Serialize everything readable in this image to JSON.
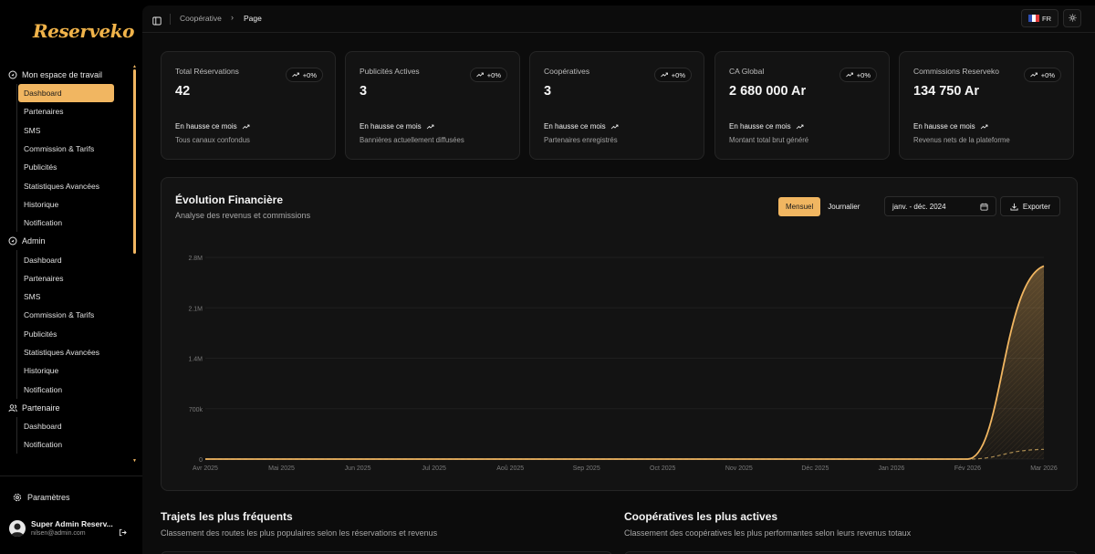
{
  "app": {
    "logo_text": "Reserveko"
  },
  "sidebar": {
    "groups": [
      {
        "label": "Mon espace de travail",
        "items": [
          "Dashboard",
          "Partenaires",
          "SMS",
          "Commission & Tarifs",
          "Publicités",
          "Statistiques Avancées",
          "Historique",
          "Notification"
        ],
        "active_index": 0
      },
      {
        "label": "Admin",
        "items": [
          "Dashboard",
          "Partenaires",
          "SMS",
          "Commission & Tarifs",
          "Publicités",
          "Statistiques Avancées",
          "Historique",
          "Notification"
        ]
      },
      {
        "label": "Partenaire",
        "items": [
          "Dashboard",
          "Notification"
        ]
      }
    ],
    "settings_label": "Paramètres",
    "user": {
      "name": "Super Admin Reserv...",
      "email": "nilsen@admin.com"
    }
  },
  "topbar": {
    "breadcrumb": [
      "Coopérative",
      "Page"
    ],
    "language": "FR"
  },
  "stats": [
    {
      "title": "Total Réservations",
      "badge": "+0%",
      "value": "42",
      "trend": "En hausse ce mois",
      "desc": "Tous canaux confondus"
    },
    {
      "title": "Publicités Actives",
      "badge": "+0%",
      "value": "3",
      "trend": "En hausse ce mois",
      "desc": "Bannières actuellement diffusées"
    },
    {
      "title": "Coopératives",
      "badge": "+0%",
      "value": "3",
      "trend": "En hausse ce mois",
      "desc": "Partenaires enregistrés"
    },
    {
      "title": "CA Global",
      "badge": "+0%",
      "value": "2 680 000 Ar",
      "trend": "En hausse ce mois",
      "desc": "Montant total brut généré"
    },
    {
      "title": "Commissions Reserveko",
      "badge": "+0%",
      "value": "134 750 Ar",
      "trend": "En hausse ce mois",
      "desc": "Revenus nets de la plateforme"
    }
  ],
  "chart_section": {
    "title": "Évolution Financière",
    "subtitle": "Analyse des revenus et commissions",
    "toggle": [
      "Mensuel",
      "Journalier"
    ],
    "toggle_active": "Mensuel",
    "date_range": "janv. - déc. 2024",
    "export_label": "Exporter"
  },
  "chart_data": {
    "type": "area",
    "x": [
      "Avr 2025",
      "Mai 2025",
      "Jun 2025",
      "Jul 2025",
      "Aoû 2025",
      "Sep 2025",
      "Oct 2025",
      "Nov 2025",
      "Déc 2025",
      "Jan 2026",
      "Fév 2026",
      "Mar 2026"
    ],
    "y_ticks": [
      "0",
      "700k",
      "1.4M",
      "2.1M",
      "2.8M"
    ],
    "ylim": [
      0,
      2800000
    ],
    "series": [
      {
        "values": [
          0,
          0,
          0,
          0,
          0,
          0,
          0,
          0,
          0,
          0,
          0,
          2680000
        ],
        "color": "#f1b661",
        "style": "solid"
      },
      {
        "values": [
          0,
          0,
          0,
          0,
          0,
          0,
          0,
          0,
          0,
          0,
          0,
          134750
        ],
        "color": "#c9a45e",
        "style": "dashed"
      }
    ],
    "grid": true
  },
  "bottom": {
    "left": {
      "title": "Trajets les plus fréquents",
      "subtitle": "Classement des routes les plus populaires selon les réservations et revenus"
    },
    "right": {
      "title": "Coopératives les plus actives",
      "subtitle": "Classement des coopératives les plus performantes selon leurs revenus totaux"
    }
  },
  "colors": {
    "accent": "#f1b661",
    "background": "#000000",
    "card": "#131313"
  }
}
